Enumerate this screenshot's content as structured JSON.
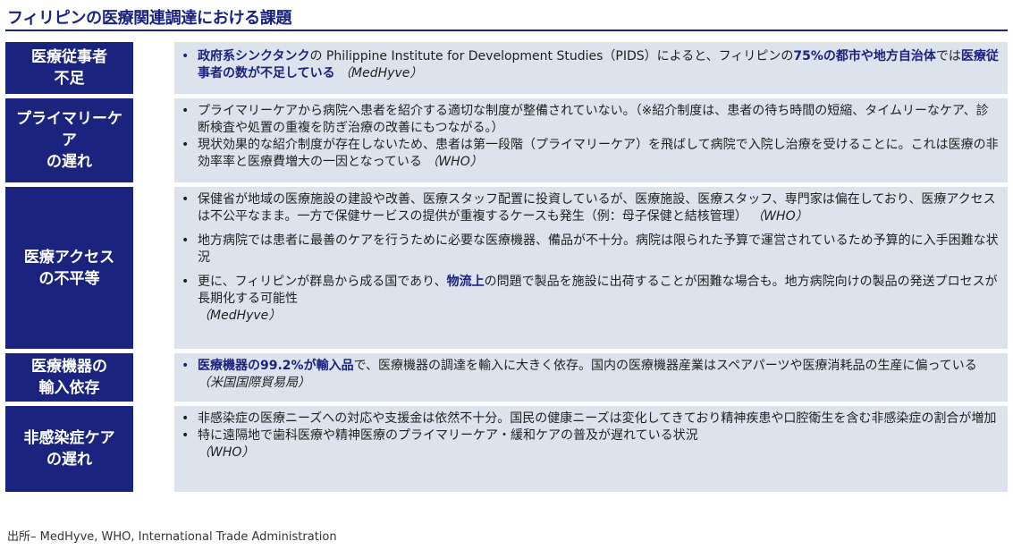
{
  "title": "フィリピンの医療関連調達における課題",
  "rows": [
    {
      "label_lines": [
        "医療従事者",
        "不足"
      ],
      "bullets": [
        [
          "政府系シンクタンク",
          "の Philippine Institute for Development Studies（PIDS）によると、フィリピンの",
          "75%の都市や地方自治体",
          "では",
          "医療従事者の数が不足している",
          "（MedHyve）"
        ]
      ]
    },
    {
      "label_lines": [
        "プライマリーケア",
        "の遅れ"
      ],
      "bullets": [
        "プライマリーケアから病院へ患者を紹介する適切な制度が整備されていない。（※紹介制度は、患者の待ち時間の短縮、タイムリーなケア、診断検査や処置の重複を防ぎ治療の改善にもつながる。）",
        [
          "現状効果的な紹介制度が存在しないため、患者は第一段階（プライマリーケア）を飛ばして病院で入院し治療を受けることに。これは医療の非効率率と医療費増大の一因となっている",
          "（WHO）"
        ]
      ]
    },
    {
      "label_lines": [
        "医療アクセス",
        "の不平等"
      ],
      "bullets": [
        [
          "保健省が地域の医療施設の建設や改善、医療スタッフ配置に投資しているが、医療施設、医療スタッフ、専門家は偏在しており、医療アクセスは不公平なまま。一方で保健サービスの提供が重複するケースも発生（例：母子保健と結核管理）",
          "（WHO）"
        ],
        "地方病院では患者に最善のケアを行うために必要な医療機器、備品が不十分。病院は限られた予算で運営されているため予算的に入手困難な状況",
        [
          "更に、フィリピンが群島から成る国であり、",
          "物流上",
          "の問題で製品を施設に出荷することが困難な場合も。地方病院向けの製品の発送プロセスが長期化する可能性",
          "（MedHyve）"
        ]
      ]
    },
    {
      "label_lines": [
        "医療機器の",
        "輸入依存"
      ],
      "bullets": [
        [
          "医療機器の99.2%が輸入品",
          "で、医療機器の調達を輸入に大きく依存。国内の医療機器産業はスペアパーツや医療消耗品の生産に偏っている",
          "（米国国際貿易局）"
        ]
      ]
    },
    {
      "label_lines": [
        "非感染症ケア",
        "の遅れ"
      ],
      "bullets": [
        "非感染症の医療ニーズへの対応や支援金は依然不十分。国民の健康ニーズは変化してきており精神疾患や口腔衛生を含む非感染症の割合が増加",
        [
          "特に遠隔地で歯科医療や精神医療のプライマリーケア・緩和ケアの普及が遅れている状況",
          "（WHO）"
        ]
      ]
    }
  ],
  "footer": "出所– MedHyve, WHO, International Trade Administration",
  "colors": {
    "accent": "#1a237e",
    "panel": "#dde3ed"
  }
}
